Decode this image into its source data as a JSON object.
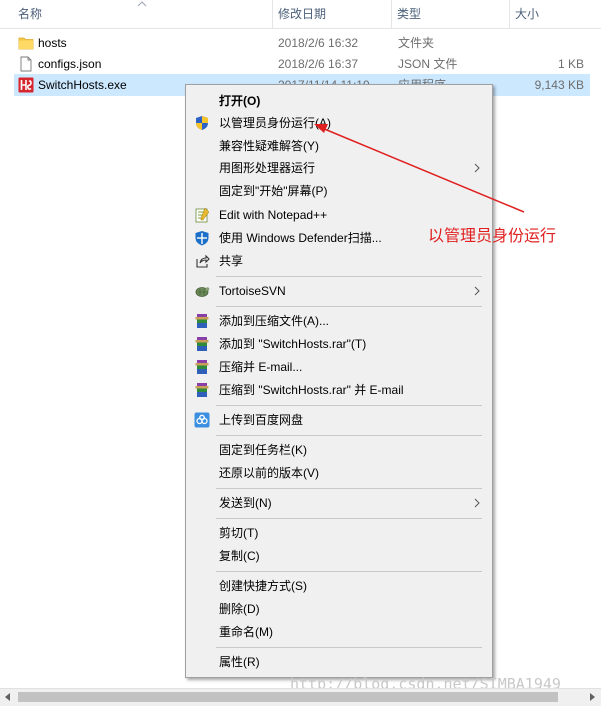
{
  "columns": {
    "name": "名称",
    "date": "修改日期",
    "type": "类型",
    "size": "大小"
  },
  "files": [
    {
      "name": "hosts",
      "date": "2018/2/6 16:32",
      "type": "文件夹",
      "size": "",
      "icon": "folder-icon"
    },
    {
      "name": "configs.json",
      "date": "2018/2/6 16:37",
      "type": "JSON 文件",
      "size": "1 KB",
      "icon": "document-icon"
    },
    {
      "name": "SwitchHosts.exe",
      "date": "2017/11/14 11:19",
      "type": "应用程序",
      "size": "9,143 KB",
      "icon": "switchhosts-app-icon",
      "selected": true
    }
  ],
  "menu": {
    "open": "打开(O)",
    "run_as_admin": "以管理员身份运行(A)",
    "troubleshoot_compat": "兼容性疑难解答(Y)",
    "run_with_gpu": "用图形处理器运行",
    "pin_to_start": "固定到\"开始\"屏幕(P)",
    "edit_notepad": "Edit with Notepad++",
    "defender_scan": "使用 Windows Defender扫描...",
    "share": "共享",
    "tortoisesvn": "TortoiseSVN",
    "add_to_archive": "添加到压缩文件(A)...",
    "add_to_rar": "添加到 \"SwitchHosts.rar\"(T)",
    "compress_email": "压缩并 E-mail...",
    "compress_rar_email": "压缩到 \"SwitchHosts.rar\" 并 E-mail",
    "upload_baidu": "上传到百度网盘",
    "pin_taskbar": "固定到任务栏(K)",
    "restore_versions": "还原以前的版本(V)",
    "send_to": "发送到(N)",
    "cut": "剪切(T)",
    "copy": "复制(C)",
    "create_shortcut": "创建快捷方式(S)",
    "delete": "删除(D)",
    "rename": "重命名(M)",
    "properties": "属性(R)"
  },
  "annotation": {
    "text": "以管理员身份运行",
    "color": "#e02020"
  },
  "watermark": "http://blog.csdn.net/SIMBA1949",
  "colors": {
    "selection": "#cce8ff",
    "menu_bg": "#f0f0f0",
    "header_text": "#4c607a"
  }
}
